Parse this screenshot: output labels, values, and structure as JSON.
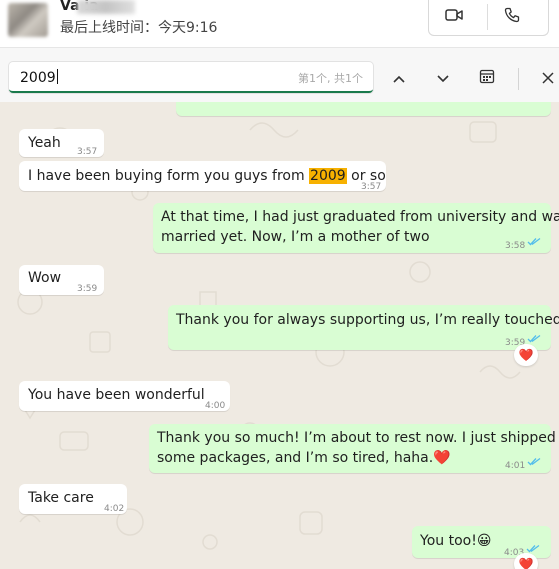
{
  "header": {
    "contact_name": "Va           ia",
    "last_seen": "最后上线时间：今天9:16",
    "video_call_icon": "video-camera-icon",
    "voice_call_icon": "phone-icon"
  },
  "search": {
    "value": "2009",
    "match_count": "第1个, 共1个",
    "prev_icon": "chevron-up-icon",
    "next_icon": "chevron-down-icon",
    "calendar_icon": "calendar-icon",
    "close_icon": "close-icon"
  },
  "messages": [
    {
      "dir": "in",
      "text": "Yeah",
      "time": "3:57"
    },
    {
      "dir": "in",
      "text_before": "I have been buying form you guys from ",
      "highlight": "2009",
      "text_after": " or so",
      "time": "3:57"
    },
    {
      "dir": "out",
      "line1": "At that time, I had just graduated from university and wasn’t",
      "line2": "married yet. Now, I’m a mother of two",
      "time": "3:58",
      "status": "read"
    },
    {
      "dir": "in",
      "text": "Wow",
      "time": "3:59"
    },
    {
      "dir": "out",
      "text": "Thank you for always supporting us, I’m really touched.🙏",
      "time": "3:59",
      "status": "read",
      "reaction": "❤️"
    },
    {
      "dir": "in",
      "text": "You have been wonderful",
      "time": "4:00"
    },
    {
      "dir": "out",
      "line1": "Thank you so much! I’m about to rest now. I just shipped out",
      "line2": "some packages, and I’m so tired, haha.❤️",
      "time": "4:01",
      "status": "read"
    },
    {
      "dir": "in",
      "text": "Take care",
      "time": "4:02"
    },
    {
      "dir": "out",
      "text": "You too!😀",
      "time": "4:03",
      "status": "read",
      "reaction": "❤️"
    }
  ],
  "colors": {
    "incoming_bubble": "#ffffff",
    "outgoing_bubble": "#d9fdd3",
    "chat_background": "#efeae2",
    "search_highlight": "#f7b100",
    "read_ticks": "#53bdeb",
    "search_underline": "#1a7a4c",
    "reaction_heart": "#e8213b"
  }
}
